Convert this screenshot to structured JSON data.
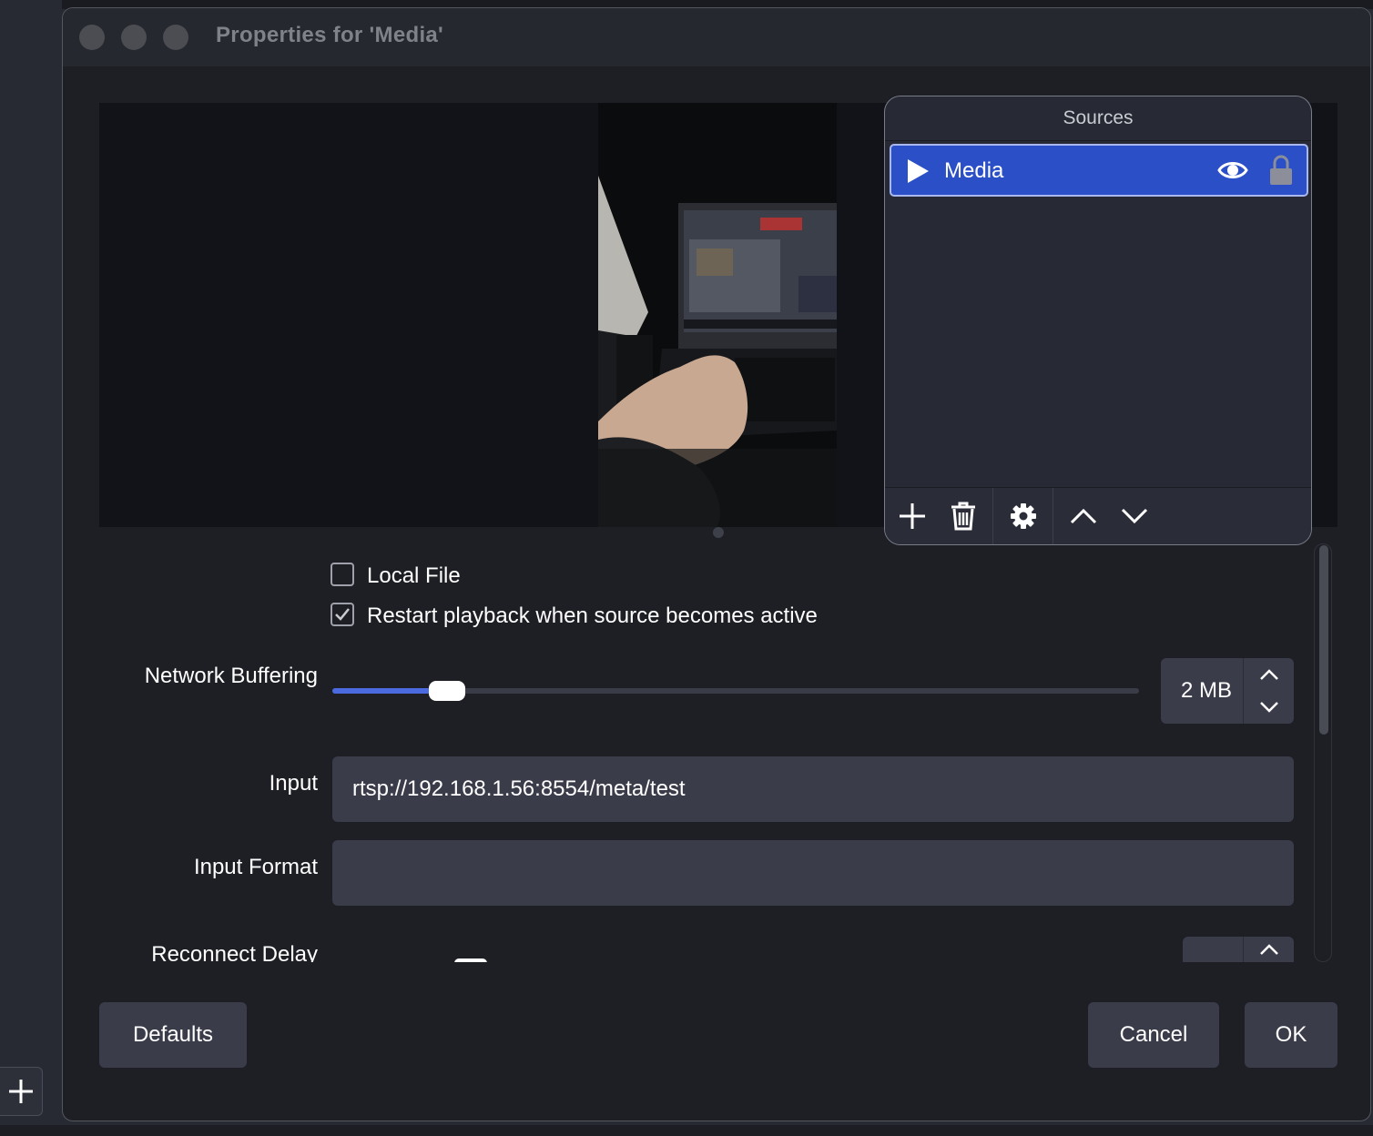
{
  "window": {
    "title": "Properties for 'Media'"
  },
  "sources": {
    "header": "Sources",
    "items": [
      {
        "label": "Media",
        "icon": "play-icon",
        "visible": true,
        "locked": true
      }
    ],
    "toolbar": [
      "add-icon",
      "trash-icon",
      "gear-icon",
      "chevron-up-icon",
      "chevron-down-icon"
    ]
  },
  "form": {
    "local_file": {
      "label": "Local File",
      "checked": false
    },
    "restart_playback": {
      "label": "Restart playback when source becomes active",
      "checked": true
    },
    "network_buffering": {
      "label": "Network Buffering",
      "value": "2 MB",
      "slider_fraction": 0.14
    },
    "input": {
      "label": "Input",
      "value": "rtsp://192.168.1.56:8554/meta/test"
    },
    "input_format": {
      "label": "Input Format",
      "value": ""
    },
    "reconnect_delay": {
      "label": "Reconnect Delay"
    }
  },
  "footer": {
    "defaults": "Defaults",
    "cancel": "Cancel",
    "ok": "OK"
  },
  "colors": {
    "accent": "#2a4fc6",
    "slider_fill": "#4c6ae0",
    "window_bg": "#1e1f25",
    "field_bg": "#3a3c4a"
  }
}
